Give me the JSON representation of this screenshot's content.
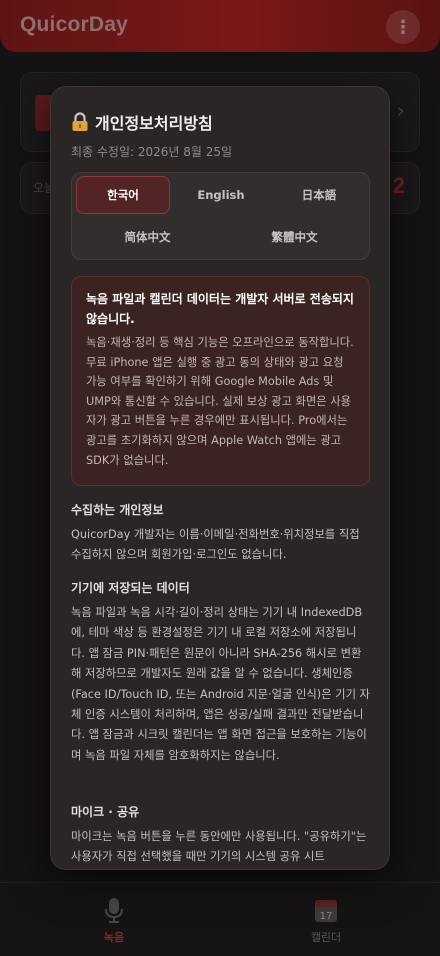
{
  "app": {
    "title": "QuicorDay",
    "menu_icon": "⋮",
    "today_label": "오늘",
    "today_count": "2"
  },
  "bottom_nav": {
    "items": [
      {
        "label": "녹음",
        "icon": "microphone-icon",
        "active": true
      },
      {
        "label": "캘린더",
        "icon": "calendar-icon",
        "active": false
      }
    ],
    "calendar_day": "17"
  },
  "modal": {
    "title": "개인정보처리방침",
    "updated": "최종 수정일: 2026년 8월 25일",
    "languages": [
      {
        "label": "한국어",
        "active": true
      },
      {
        "label": "English",
        "active": false
      },
      {
        "label": "日本語",
        "active": false
      },
      {
        "label": "简体中文",
        "active": false
      },
      {
        "label": "繁體中文",
        "active": false
      }
    ],
    "notice": {
      "title": "녹음 파일과 캘린더 데이터는 개발자 서버로 전송되지 않습니다.",
      "body": "녹음·재생·정리 등 핵심 기능은 오프라인으로 동작합니다. 무료 iPhone 앱은 실행 중 광고 동의 상태와 광고 요청 가능 여부를 확인하기 위해 Google Mobile Ads 및 UMP와 통신할 수 있습니다. 실제 보상 광고 화면은 사용자가 광고 버튼을 누른 경우에만 표시됩니다. Pro에서는 광고를 초기화하지 않으며 Apple Watch 앱에는 광고 SDK가 없습니다."
    },
    "sections": [
      {
        "title": "수집하는 개인정보",
        "body": "QuicorDay 개발자는 이름·이메일·전화번호·위치정보를 직접 수집하지 않으며 회원가입·로그인도 없습니다."
      },
      {
        "title": "기기에 저장되는 데이터",
        "body": "녹음 파일과 녹음 시각·길이·정리 상태는 기기 내 IndexedDB에, 테마 색상 등 환경설정은 기기 내 로컬 저장소에 저장됩니다. 앱 잠금 PIN·패턴은 원문이 아니라 SHA-256 해시로 변환해 저장하므로 개발자도 원래 값을 알 수 없습니다. 생체인증(Face ID/Touch ID, 또는 Android 지문·얼굴 인식)은 기기 자체 인증 시스템이 처리하며, 앱은 성공/실패 결과만 전달받습니다. 앱 잠금과 시크릿 캘린더는 앱 화면 접근을 보호하는 기능이며 녹음 파일 자체를 암호화하지는 않습니다."
      },
      {
        "title": "마이크 · 공유",
        "body": "마이크는 녹음 버튼을 누른 동안에만 사용됩니다. \"공유하기\"는 사용자가 직접 선택했을 때만 기기의 시스템 공유 시트"
      }
    ]
  }
}
